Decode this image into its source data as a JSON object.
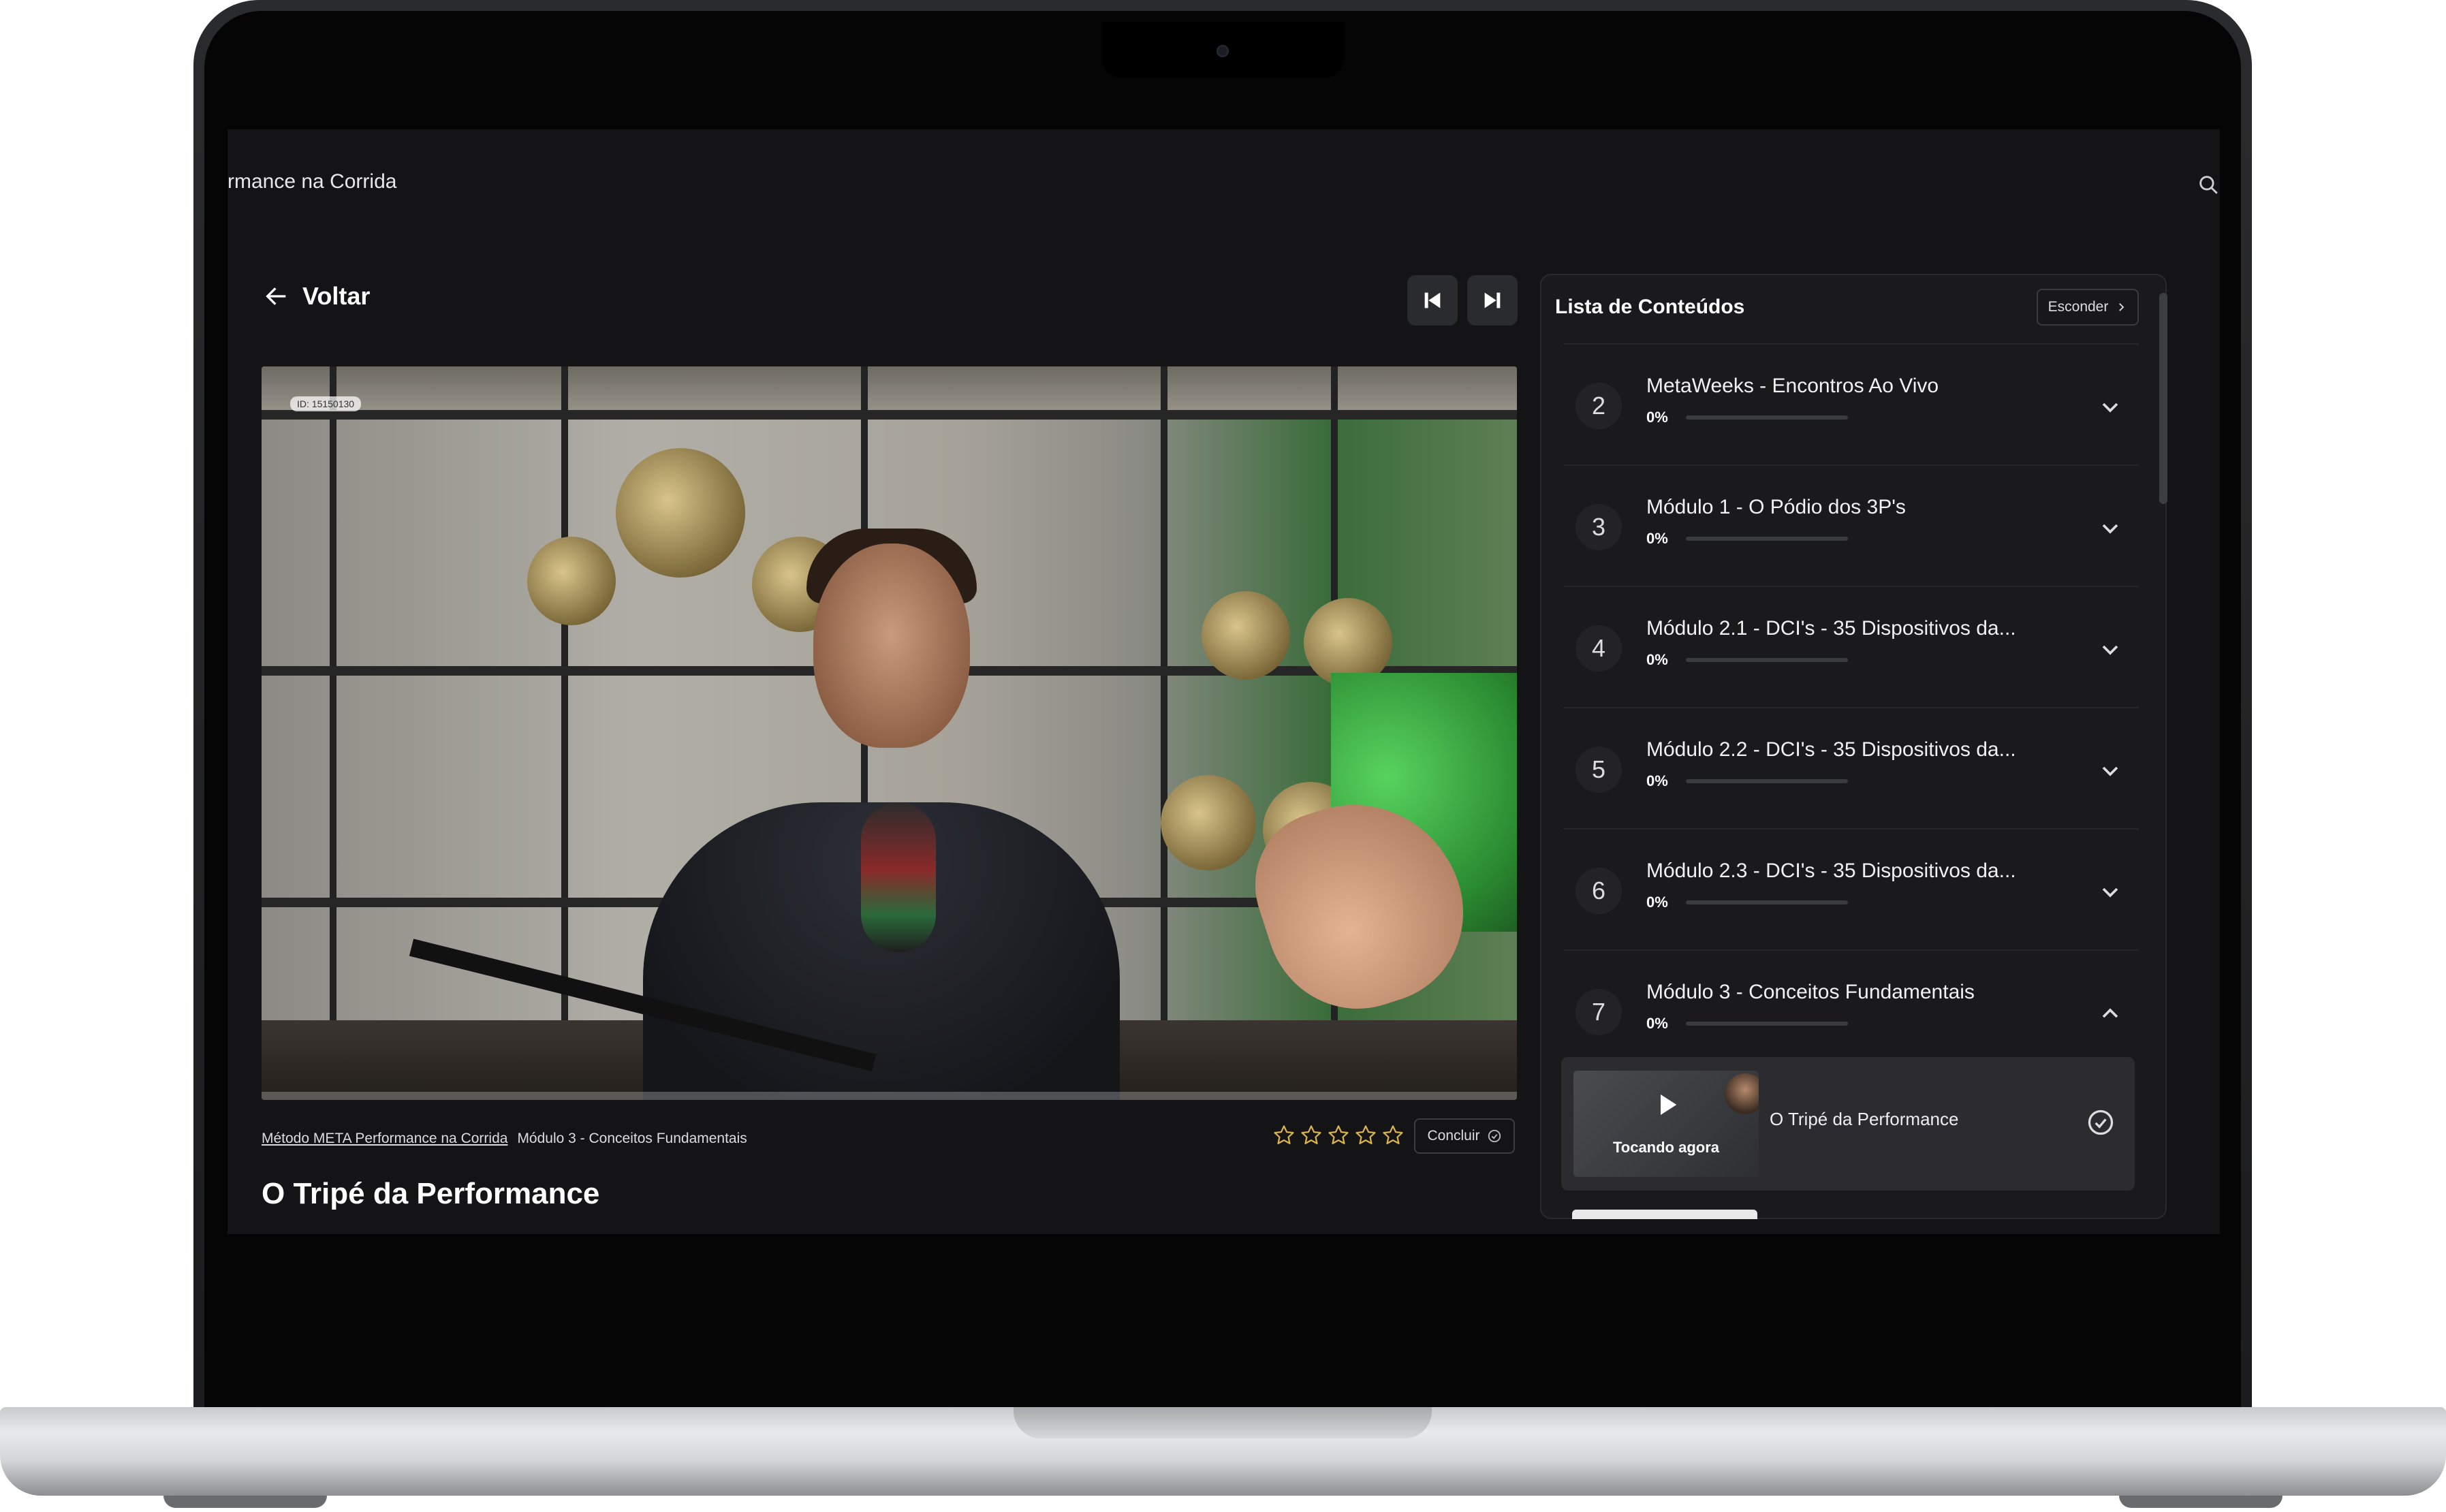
{
  "header": {
    "app_title": "rmance na Corrida"
  },
  "nav": {
    "back_label": "Voltar"
  },
  "video": {
    "id_badge": "ID: 15150130"
  },
  "breadcrumb": {
    "course_link": "Método META Performance na Corrida",
    "module": "Módulo 3 - Conceitos Fundamentais"
  },
  "rating": {
    "max_stars": 5,
    "value": 0
  },
  "actions": {
    "conclude_label": "Concluir"
  },
  "lesson": {
    "title": "O Tripé da Performance"
  },
  "sidebar": {
    "title": "Lista de Conteúdos",
    "hide_label": "Esconder",
    "modules": [
      {
        "number": "2",
        "title": "MetaWeeks - Encontros Ao Vivo",
        "progress_label": "0%",
        "progress": 0,
        "expanded": false
      },
      {
        "number": "3",
        "title": "Módulo 1 - O Pódio dos 3P's",
        "progress_label": "0%",
        "progress": 0,
        "expanded": false
      },
      {
        "number": "4",
        "title": "Módulo 2.1 - DCI's - 35 Dispositivos da...",
        "progress_label": "0%",
        "progress": 0,
        "expanded": false
      },
      {
        "number": "5",
        "title": "Módulo 2.2 - DCI's - 35 Dispositivos da...",
        "progress_label": "0%",
        "progress": 0,
        "expanded": false
      },
      {
        "number": "6",
        "title": "Módulo 2.3 - DCI's - 35 Dispositivos da...",
        "progress_label": "0%",
        "progress": 0,
        "expanded": false
      },
      {
        "number": "7",
        "title": "Módulo 3 - Conceitos Fundamentais",
        "progress_label": "0%",
        "progress": 0,
        "expanded": true
      }
    ],
    "now_playing": {
      "label": "Tocando agora",
      "title": "O Tripé da Performance"
    }
  },
  "colors": {
    "screen_bg": "#141416",
    "panel_bg": "#1a1a1c",
    "star": "#d9b44a"
  }
}
